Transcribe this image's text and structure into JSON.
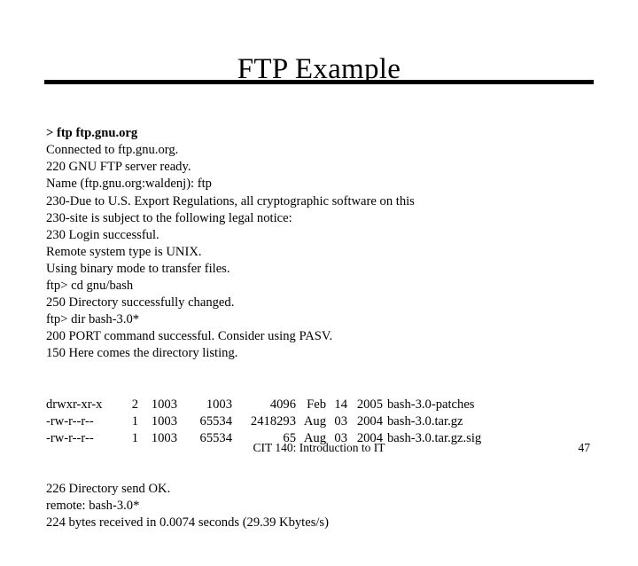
{
  "slide": {
    "title": "FTP Example",
    "footer": "CIT 140: Introduction to IT",
    "page_number": "47"
  },
  "transcript": {
    "lines": [
      {
        "text": "> ftp ftp.gnu.org",
        "bold": true
      },
      {
        "text": "Connected to ftp.gnu.org.",
        "bold": false
      },
      {
        "text": "220 GNU FTP server ready.",
        "bold": false
      },
      {
        "text": "Name (ftp.gnu.org:waldenj): ftp",
        "bold": false
      },
      {
        "text": "230-Due to U.S. Export Regulations, all cryptographic software on this",
        "bold": false
      },
      {
        "text": "230-site is subject to the following legal notice:",
        "bold": false
      },
      {
        "text": "230 Login successful.",
        "bold": false
      },
      {
        "text": "Remote system type is UNIX.",
        "bold": false
      },
      {
        "text": "Using binary mode to transfer files.",
        "bold": false
      },
      {
        "text": "ftp> cd gnu/bash",
        "bold": false
      },
      {
        "text": "250 Directory successfully changed.",
        "bold": false
      },
      {
        "text": "ftp> dir bash-3.0*",
        "bold": false
      },
      {
        "text": "200 PORT command successful. Consider using PASV.",
        "bold": false
      },
      {
        "text": "150 Here comes the directory listing.",
        "bold": false
      }
    ],
    "listing": [
      {
        "permissions": "drwxr-xr-x",
        "links": "2",
        "owner": "1003",
        "group": "1003",
        "size": "4096",
        "month": "Feb",
        "day": "14",
        "year": "2005",
        "name": "bash-3.0-patches"
      },
      {
        "permissions": "-rw-r--r--",
        "links": "1",
        "owner": "1003",
        "group": "65534",
        "size": "2418293",
        "month": "Aug",
        "day": "03",
        "year": "2004",
        "name": "bash-3.0.tar.gz"
      },
      {
        "permissions": "-rw-r--r--",
        "links": "1",
        "owner": "1003",
        "group": "65534",
        "size": "65",
        "month": "Aug",
        "day": "03",
        "year": "2004",
        "name": "bash-3.0.tar.gz.sig"
      }
    ],
    "lines_after": [
      {
        "text": "226 Directory send OK.",
        "bold": false
      },
      {
        "text": "remote: bash-3.0*",
        "bold": false
      },
      {
        "text": "224 bytes received in 0.0074 seconds (29.39 Kbytes/s)",
        "bold": false
      }
    ]
  }
}
